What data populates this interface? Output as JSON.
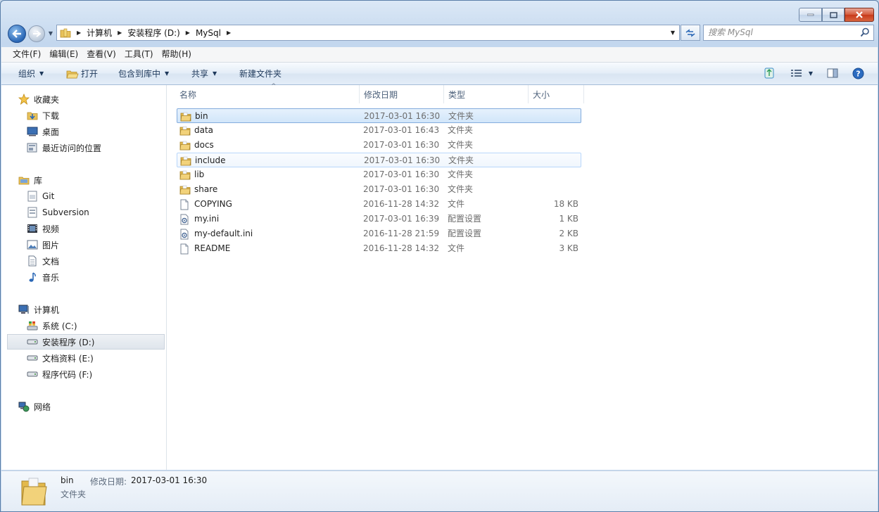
{
  "address": {
    "segments": [
      "计算机",
      "安装程序 (D:)",
      "MySql"
    ],
    "search_placeholder": "搜索 MySql"
  },
  "menu": [
    "文件(F)",
    "编辑(E)",
    "查看(V)",
    "工具(T)",
    "帮助(H)"
  ],
  "commands": {
    "organize": "组织",
    "open": "打开",
    "include_in_library": "包含到库中",
    "share": "共享",
    "new_folder": "新建文件夹"
  },
  "nav": {
    "favorites": {
      "title": "收藏夹",
      "items": [
        "下载",
        "桌面",
        "最近访问的位置"
      ]
    },
    "libraries": {
      "title": "库",
      "items": [
        "Git",
        "Subversion",
        "视频",
        "图片",
        "文档",
        "音乐"
      ]
    },
    "computer": {
      "title": "计算机",
      "items": [
        "系统 (C:)",
        "安装程序 (D:)",
        "文档资料 (E:)",
        "程序代码 (F:)"
      ]
    },
    "network": {
      "title": "网络"
    }
  },
  "columns": {
    "name": "名称",
    "date": "修改日期",
    "type": "类型",
    "size": "大小"
  },
  "files": [
    {
      "name": "bin",
      "date": "2017-03-01 16:30",
      "type": "文件夹",
      "size": "",
      "kind": "folder"
    },
    {
      "name": "data",
      "date": "2017-03-01 16:43",
      "type": "文件夹",
      "size": "",
      "kind": "folder"
    },
    {
      "name": "docs",
      "date": "2017-03-01 16:30",
      "type": "文件夹",
      "size": "",
      "kind": "folder"
    },
    {
      "name": "include",
      "date": "2017-03-01 16:30",
      "type": "文件夹",
      "size": "",
      "kind": "folder"
    },
    {
      "name": "lib",
      "date": "2017-03-01 16:30",
      "type": "文件夹",
      "size": "",
      "kind": "folder"
    },
    {
      "name": "share",
      "date": "2017-03-01 16:30",
      "type": "文件夹",
      "size": "",
      "kind": "folder"
    },
    {
      "name": "COPYING",
      "date": "2016-11-28 14:32",
      "type": "文件",
      "size": "18 KB",
      "kind": "file"
    },
    {
      "name": "my.ini",
      "date": "2017-03-01 16:39",
      "type": "配置设置",
      "size": "1 KB",
      "kind": "ini"
    },
    {
      "name": "my-default.ini",
      "date": "2016-11-28 21:59",
      "type": "配置设置",
      "size": "2 KB",
      "kind": "ini"
    },
    {
      "name": "README",
      "date": "2016-11-28 14:32",
      "type": "文件",
      "size": "3 KB",
      "kind": "file"
    }
  ],
  "details": {
    "name": "bin",
    "date_label": "修改日期:",
    "date_value": "2017-03-01 16:30",
    "type": "文件夹"
  },
  "colors": {
    "folder": "#e8c25a",
    "selection": "#84acdd",
    "accent": "#2a67b6"
  }
}
